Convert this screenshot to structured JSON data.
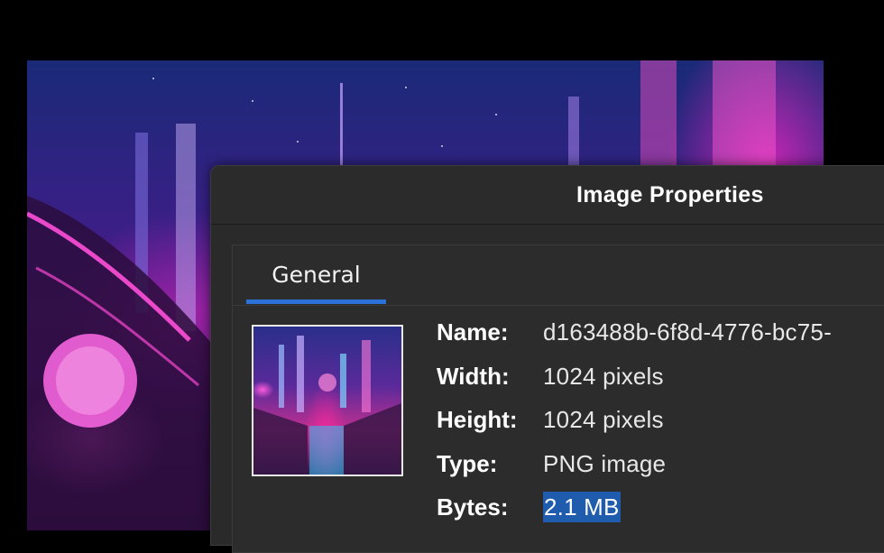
{
  "viewer": {
    "image_icon": "cyberpunk-cityscape-image"
  },
  "dialog": {
    "title": "Image Properties",
    "tabs": [
      {
        "label": "General",
        "active": true
      }
    ],
    "thumbnail_icon": "image-thumbnail",
    "properties": [
      {
        "label": "Name:",
        "value": "d163488b-6f8d-4776-bc75-"
      },
      {
        "label": "Width:",
        "value": "1024 pixels"
      },
      {
        "label": "Height:",
        "value": "1024 pixels"
      },
      {
        "label": "Type:",
        "value": "PNG image"
      },
      {
        "label": "Bytes:",
        "value": "2.1 MB",
        "selected": true
      }
    ]
  },
  "colors": {
    "accent": "#2a72d8",
    "selection": "#1f5cae",
    "dialog_bg": "#2a2a2a"
  }
}
